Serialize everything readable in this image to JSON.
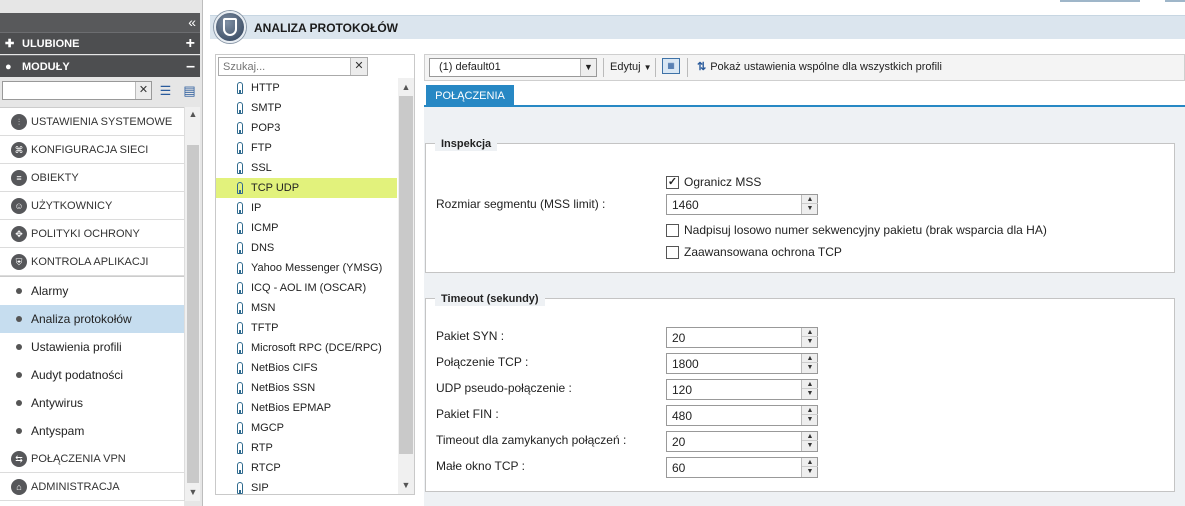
{
  "sidebar": {
    "favorites_label": "ULUBIONE",
    "modules_label": "MODUŁY",
    "search_value": "",
    "nav_items": [
      {
        "label": "USTAWIENIA SYSTEMOWE",
        "icon": "settings-sliders-icon"
      },
      {
        "label": "KONFIGURACJA SIECI",
        "icon": "network-icon"
      },
      {
        "label": "OBIEKTY",
        "icon": "database-icon"
      },
      {
        "label": "UŻYTKOWNICY",
        "icon": "users-icon"
      },
      {
        "label": "POLITYKI OCHRONY",
        "icon": "policy-icon"
      },
      {
        "label": "KONTROLA APLIKACJI",
        "icon": "shield-icon"
      }
    ],
    "sub_items": [
      "Alarmy",
      "Analiza protokołów",
      "Ustawienia profili",
      "Audyt podatności",
      "Antywirus",
      "Antyspam"
    ],
    "active_sub": "Analiza protokołów",
    "bottom_items": [
      {
        "label": "POŁĄCZENIA VPN",
        "icon": "vpn-icon"
      },
      {
        "label": "ADMINISTRACJA",
        "icon": "admin-icon"
      }
    ]
  },
  "header": {
    "title": "ANALIZA PROTOKOŁÓW"
  },
  "protocol_list": {
    "search_placeholder": "Szukaj...",
    "selected": "TCP UDP",
    "items": [
      "HTTP",
      "SMTP",
      "POP3",
      "FTP",
      "SSL",
      "TCP UDP",
      "IP",
      "ICMP",
      "DNS",
      "Yahoo Messenger (YMSG)",
      "ICQ - AOL IM (OSCAR)",
      "MSN",
      "TFTP",
      "Microsoft RPC (DCE/RPC)",
      "NetBios CIFS",
      "NetBios SSN",
      "NetBios EPMAP",
      "MGCP",
      "RTP",
      "RTCP",
      "SIP"
    ]
  },
  "toolbar": {
    "profile_value": "(1) default01",
    "edit_label": "Edytuj",
    "share_label": "Pokaż ustawienia wspólne dla wszystkich profili"
  },
  "tabs": [
    {
      "label": "POŁĄCZENIA",
      "active": true
    }
  ],
  "inspection": {
    "legend": "Inspekcja",
    "mss_label": "Rozmiar segmentu (MSS limit) :",
    "limit_mss_label": "Ogranicz MSS",
    "limit_mss_checked": true,
    "mss_value": "1460",
    "randomize_label": "Nadpisuj losowo numer sekwencyjny pakietu (brak wsparcia dla HA)",
    "randomize_checked": false,
    "advanced_label": "Zaawansowana ochrona TCP",
    "advanced_checked": false
  },
  "timeout": {
    "legend": "Timeout (sekundy)",
    "fields": [
      {
        "label": "Pakiet SYN :",
        "value": "20"
      },
      {
        "label": "Połączenie TCP :",
        "value": "1800"
      },
      {
        "label": "UDP pseudo-połączenie :",
        "value": "120"
      },
      {
        "label": "Pakiet FIN :",
        "value": "480"
      },
      {
        "label": "Timeout dla zamykanych połączeń :",
        "value": "20"
      },
      {
        "label": "Małe okno TCP :",
        "value": "60"
      }
    ]
  },
  "colors": {
    "accent": "#2788c4",
    "selected_row": "#e2f27c",
    "active_nav": "#c6ddef"
  }
}
